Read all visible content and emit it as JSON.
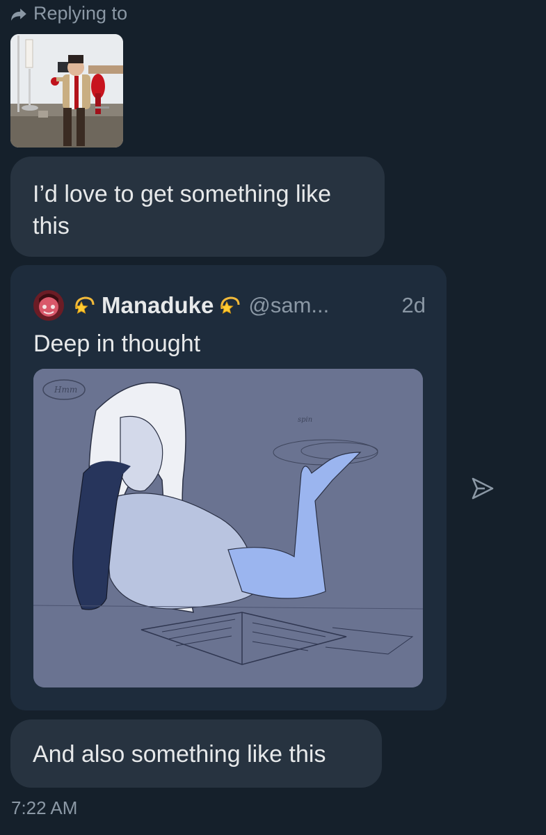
{
  "reply": {
    "label": "Replying to",
    "icon": "reply-arrow-icon"
  },
  "messages": [
    {
      "text": "I’d love to get something like this"
    },
    {
      "text": "And also something like this"
    }
  ],
  "quoted_post": {
    "author_name": "Manaduke",
    "handle": "@sam...",
    "time": "2d",
    "text": "Deep in thought",
    "name_emoji": "dizzy-star-icon",
    "sketch_notes": [
      "Hmm",
      "spin"
    ]
  },
  "timestamp": "7:22 AM",
  "colors": {
    "background": "#15202b",
    "bubble": "#273340",
    "quote_card": "#1e2c3c",
    "muted_text": "#8b98a5",
    "primary_text": "#e7e9ea"
  }
}
